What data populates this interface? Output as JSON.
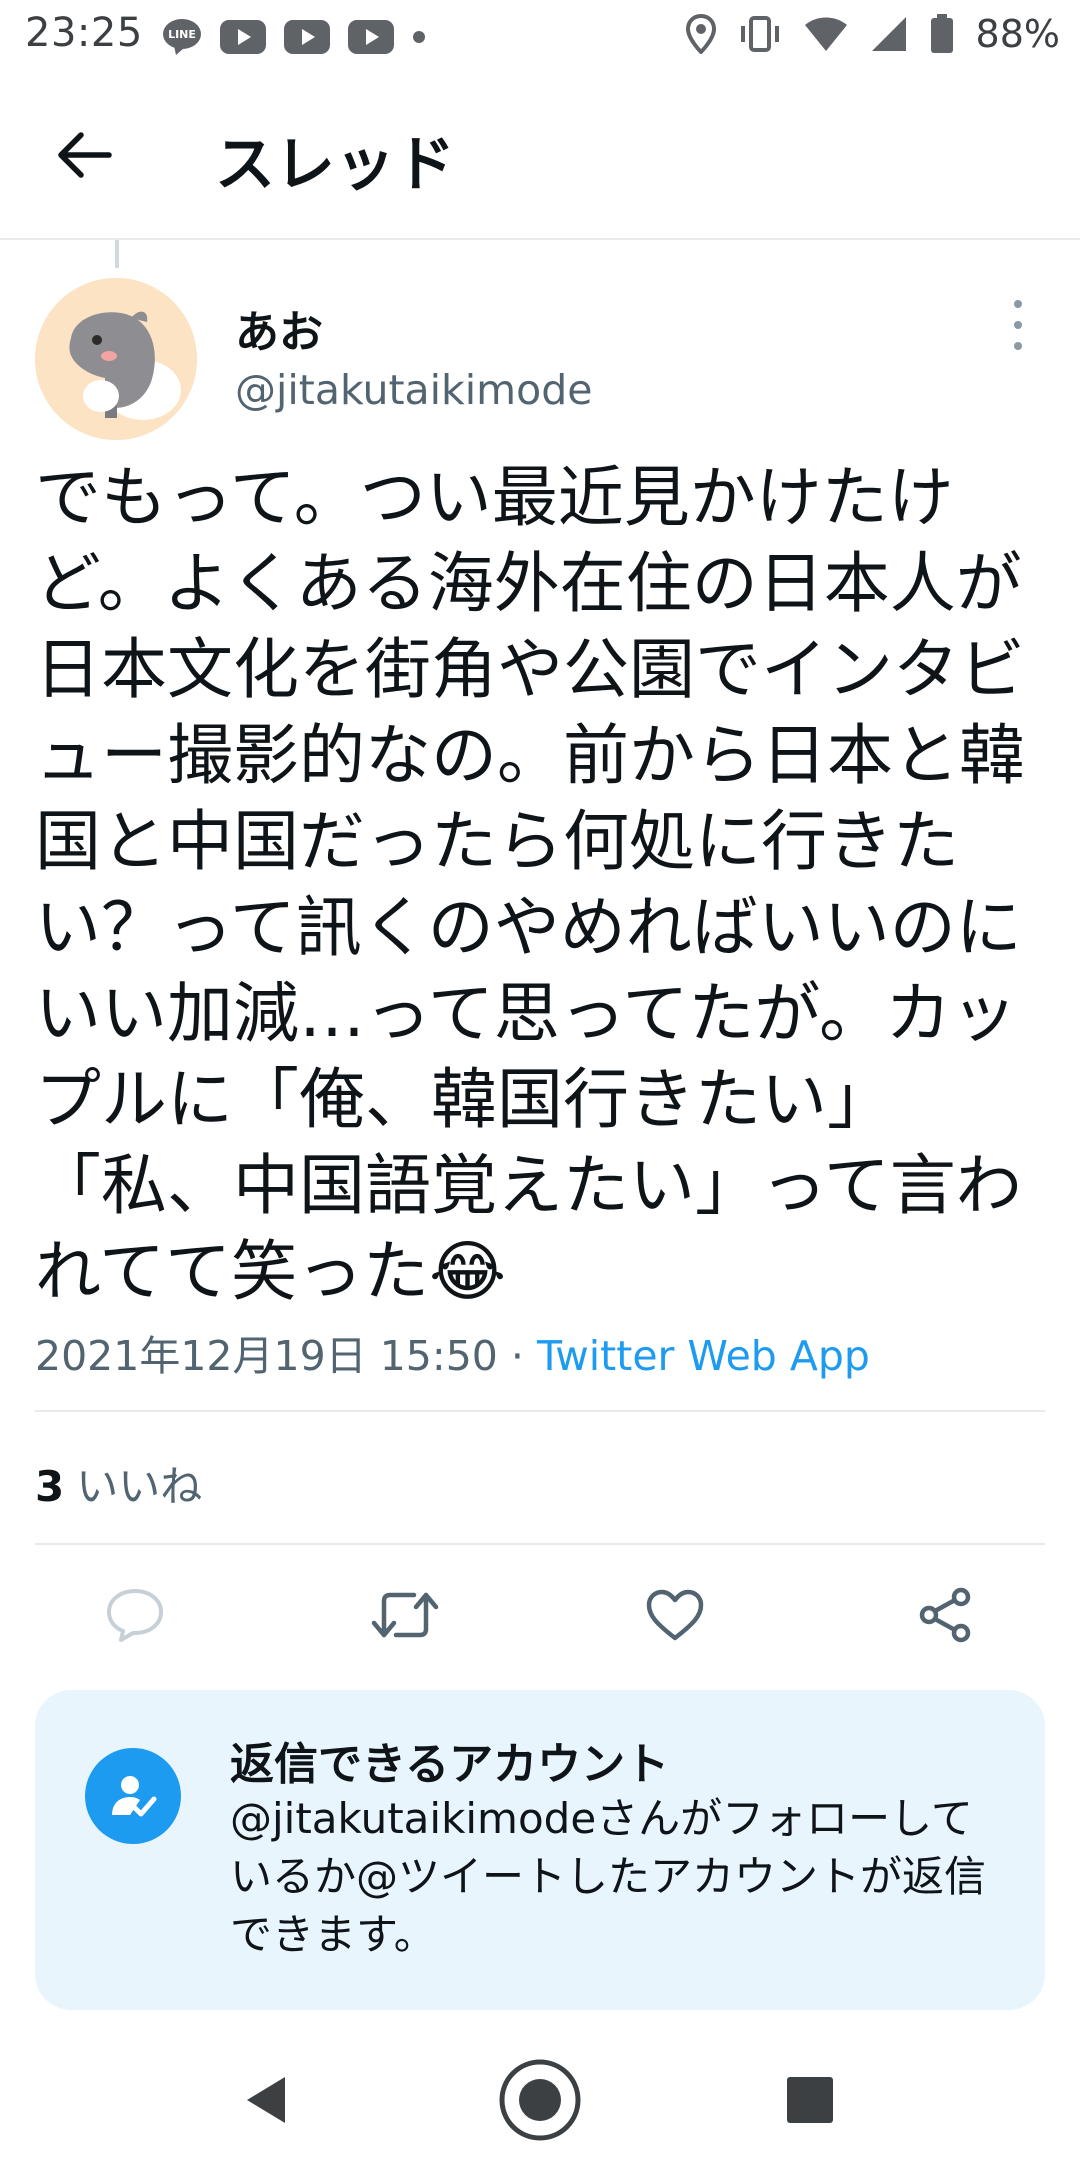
{
  "status_bar": {
    "time": "23:25",
    "battery": "88%",
    "left_icons": [
      "line-icon",
      "youtube-icon",
      "youtube-icon",
      "youtube-icon",
      "dot-icon"
    ],
    "right_icons": [
      "location-icon",
      "vibrate-icon",
      "wifi-icon",
      "signal-icon",
      "battery-icon"
    ]
  },
  "header": {
    "title": "スレッド"
  },
  "tweet": {
    "author_name": "あお",
    "author_handle": "@jitakutaikimode",
    "text": "でもって。つい最近見かけたけど。よくある海外在住の日本人が日本文化を街角や公園でインタビュー撮影的なの。前から日本と韓国と中国だったら何処に行きたい？って訊くのやめればいいのにいい加減…って思ってたが。カップルに「俺、韓国行きたい」「私、中国語覚えたい」って言われてて笑った😂",
    "datetime": "2021年12月19日 15:50",
    "separator": " · ",
    "source": "Twitter Web App",
    "likes_count": "3",
    "likes_label": "いいね"
  },
  "reply_card": {
    "title": "返信できるアカウント",
    "description": "@jitakutaikimodeさんがフォローしているか@ツイートしたアカウントが返信できます。"
  },
  "colors": {
    "accent": "#1d9bf0",
    "secondary_text": "#536471",
    "card_bg": "#e8f5fd"
  }
}
